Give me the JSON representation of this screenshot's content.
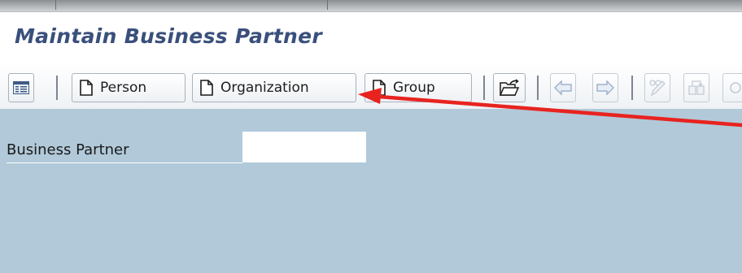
{
  "header": {
    "title": "Maintain Business Partner"
  },
  "toolbar": {
    "person_label": "Person",
    "organization_label": "Organization",
    "group_label": "Group"
  },
  "form": {
    "business_partner_label": "Business Partner",
    "business_partner_value": ""
  },
  "annotation": {
    "color": "#e8231f",
    "points_to": "organization-button"
  },
  "colors": {
    "title": "#3a4f7c",
    "content_bg": "#b1c9d9"
  }
}
